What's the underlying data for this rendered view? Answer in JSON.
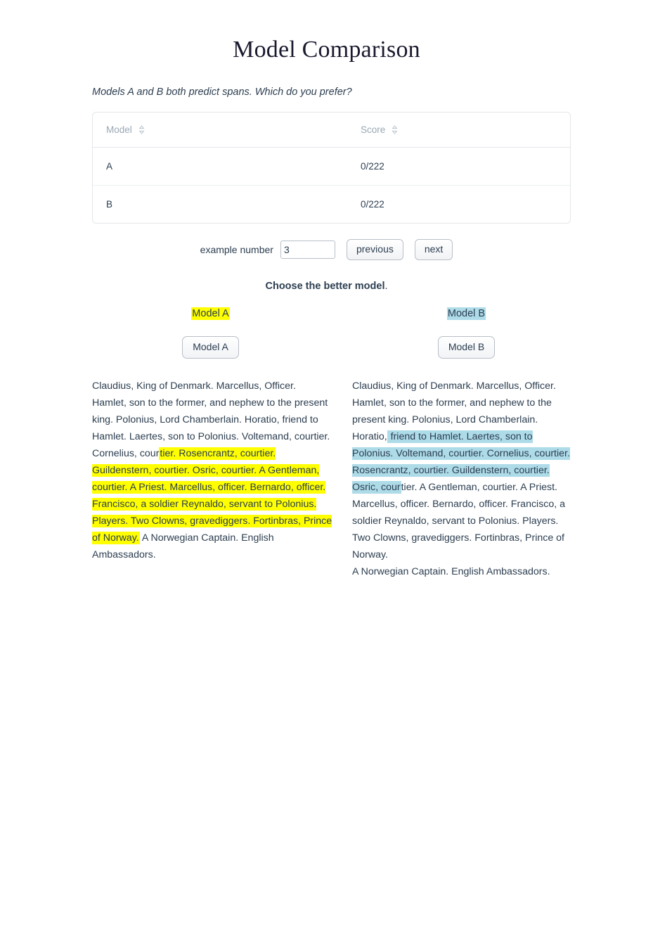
{
  "page": {
    "title": "Model Comparison",
    "prompt": "Models A and B both predict spans. Which do you prefer?"
  },
  "score_table": {
    "columns": [
      {
        "label": "Model",
        "sort_icon": "sort-chevron-icon"
      },
      {
        "label": "Score",
        "sort_icon": "sort-chevron-icon"
      }
    ],
    "rows": [
      {
        "model": "A",
        "score": "0/222"
      },
      {
        "model": "B",
        "score": "0/222"
      }
    ]
  },
  "controls": {
    "example_label": "example number",
    "example_value": "3",
    "example_placeholder": "",
    "previous_label": "previous",
    "next_label": "next"
  },
  "choose": {
    "bold": "Choose the better model",
    "period": "."
  },
  "colors": {
    "highlight_a": "#ffff00",
    "highlight_b": "#aedbe8",
    "text": "#2c3e50",
    "header_text": "#9aa7b4",
    "table_border": "#e3e6ea"
  },
  "model_a": {
    "heading": "Model A",
    "button_label": "Model A",
    "highlight_color": "#ffff00",
    "text_before": "Claudius, King of Denmark. Marcellus, Officer. Hamlet, son to the former, and nephew to the present king. Polonius, Lord Chamberlain. Horatio, friend to Hamlet. Laertes, son to Polonius. Voltemand, courtier. Cornelius, cour",
    "text_highlight": "tier. Rosencrantz, courtier. Guildenstern, courtier. Osric, courtier. A Gentleman, courtier. A Priest. Marcellus, officer. Bernardo, officer. Francisco, a soldier Reynaldo, servant to Polonius. Players. Two Clowns, gravediggers. Fortinbras, Prince of Norway.",
    "text_after": " A Norwegian Captain. English Ambassadors."
  },
  "model_b": {
    "heading": "Model B",
    "button_label": "Model B",
    "highlight_color": "#aedbe8",
    "text_before": "Claudius, King of Denmark. Marcellus, Officer. Hamlet, son to the former, and nephew to the present king. Polonius, Lord Chamberlain. Horatio,",
    "text_highlight": " friend to Hamlet. Laertes, son to Polonius. Voltemand, courtier. Cornelius, courtier. Rosencrantz, courtier. Guildenstern, courtier. Osric, cour",
    "text_after": "tier. A Gentleman, courtier. A Priest. Marcellus, officer. Bernardo, officer. Francisco, a soldier Reynaldo, servant to Polonius. Players. Two Clowns, gravediggers. Fortinbras, Prince of Norway.",
    "text_last_line": "A Norwegian Captain. English Ambassadors."
  }
}
